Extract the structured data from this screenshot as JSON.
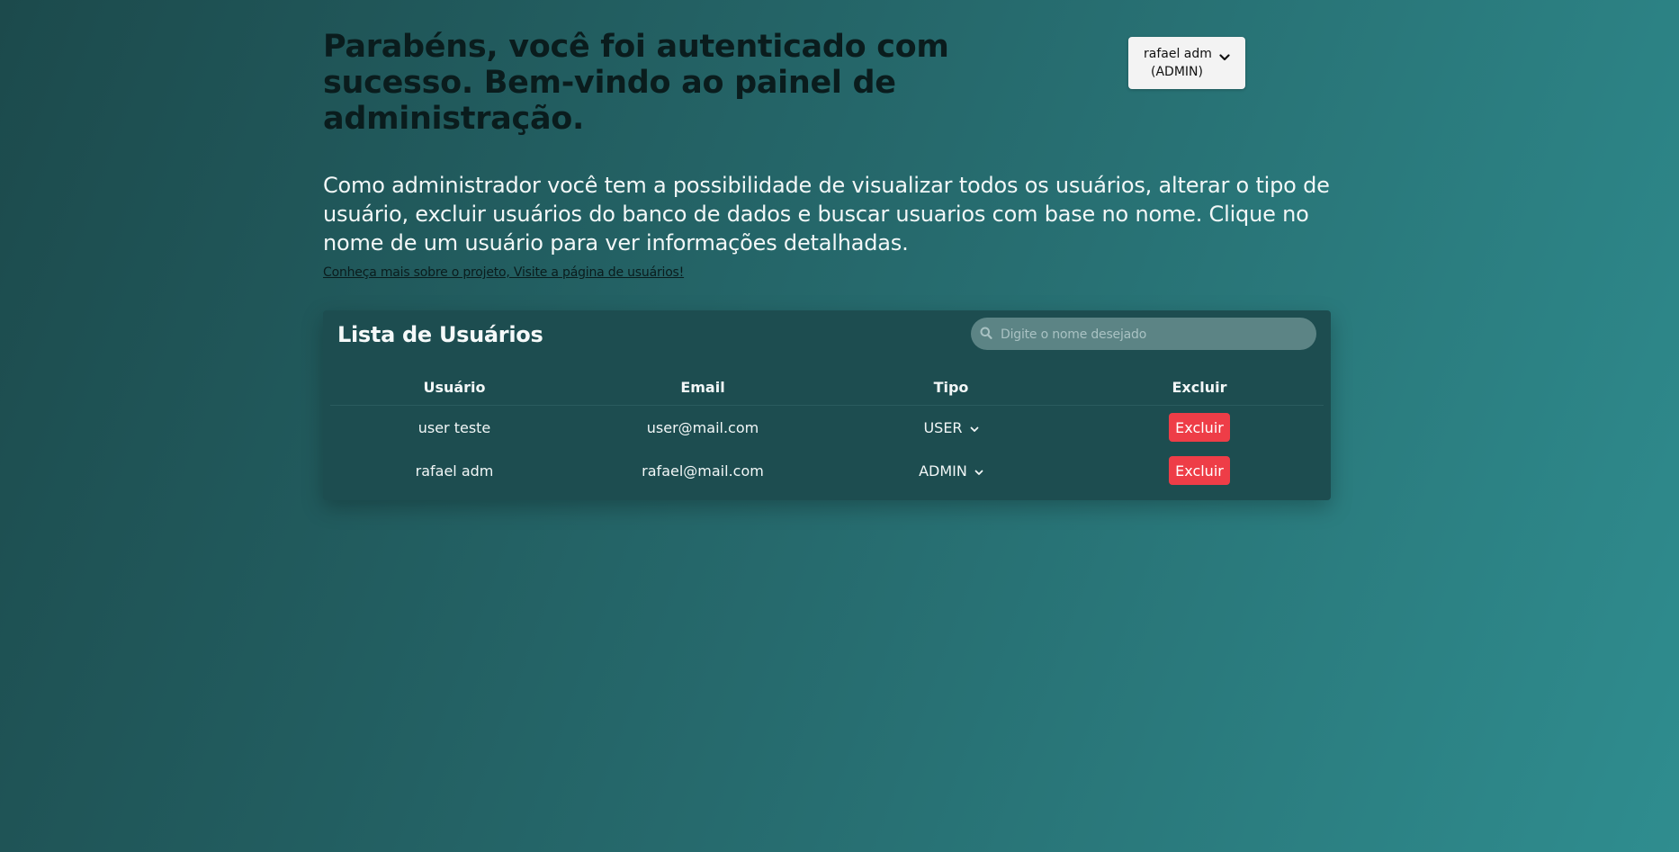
{
  "header": {
    "title": "Parabéns, você foi autenticado com sucesso. Bem-vindo ao painel de administração.",
    "description": "Como administrador você tem a possibilidade de visualizar todos os usuários, alterar o tipo de usuário, excluir usuários do banco de dados e buscar usuarios com base no nome. Clique no nome de um usuário para ver informações detalhadas.",
    "links_text": "Conheça mais sobre o projeto, Visite a página de usuários!"
  },
  "user_menu": {
    "name": "rafael adm",
    "role": "(ADMIN)",
    "icon": "chevron-down-icon"
  },
  "user_list": {
    "title": "Lista de Usuários",
    "search": {
      "placeholder": "Digite o nome desejado",
      "value": "",
      "icon": "search-icon"
    },
    "columns": [
      "Usuário",
      "Email",
      "Tipo",
      "Excluir"
    ],
    "rows": [
      {
        "name": "user teste",
        "email": "user@mail.com",
        "type": "USER",
        "delete_label": "Excluir"
      },
      {
        "name": "rafael adm",
        "email": "rafael@mail.com",
        "type": "ADMIN",
        "delete_label": "Excluir"
      }
    ]
  },
  "colors": {
    "background_start": "#1c4a4c",
    "background_end": "#2f8d8f",
    "panel": "#1d4d50",
    "delete_button": "#ee3d47",
    "search_field": "#5c8485"
  }
}
